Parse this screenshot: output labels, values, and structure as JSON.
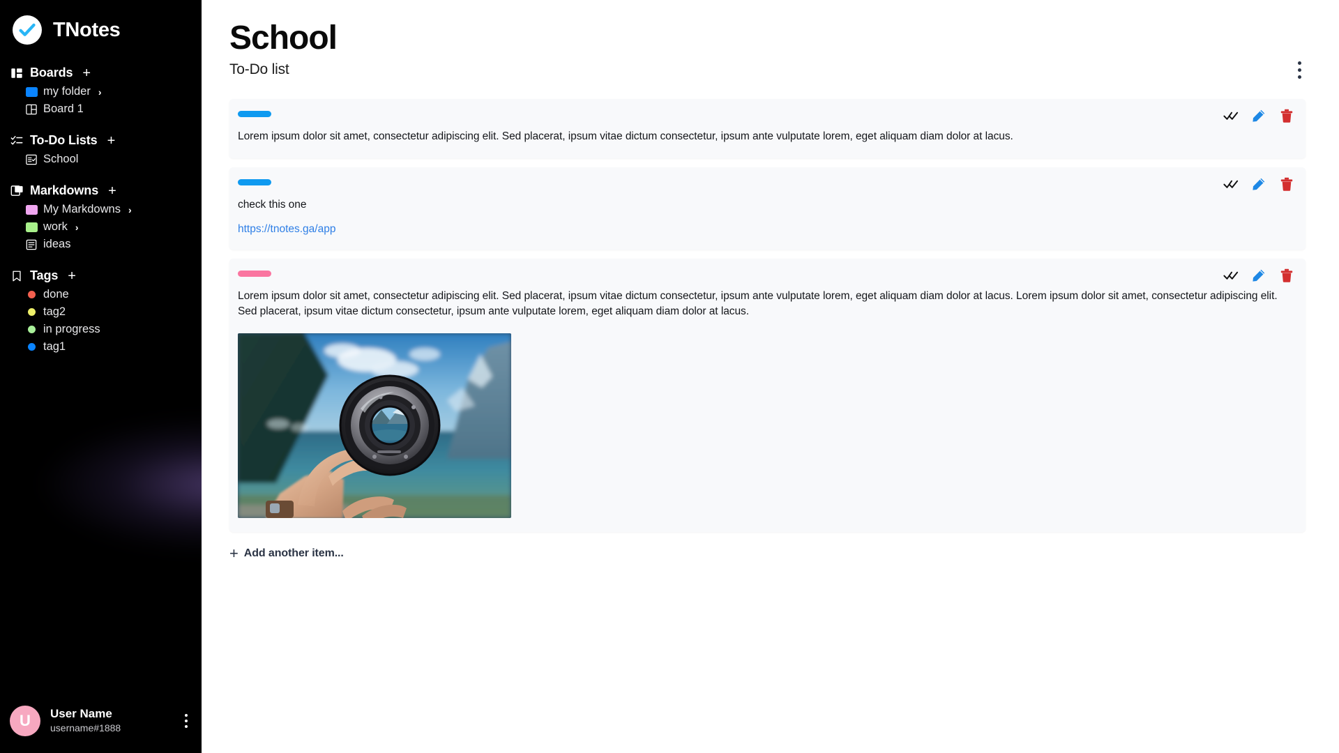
{
  "brand": {
    "name": "TNotes",
    "logo_icon": "check-circle-icon",
    "logo_color": "#29b6f6"
  },
  "sidebar": {
    "sections": [
      {
        "id": "boards",
        "title": "Boards",
        "icon": "layout-columns-icon",
        "add_label": "+",
        "items": [
          {
            "label": "my folder",
            "icon": "folder-icon",
            "color": "#0a84ff",
            "expandable": true,
            "caret": "›"
          },
          {
            "label": "Board 1",
            "icon": "board-grid-icon",
            "color": "#ffffff",
            "expandable": false,
            "caret": ""
          }
        ]
      },
      {
        "id": "todo-lists",
        "title": "To-Do Lists",
        "icon": "checklist-icon",
        "add_label": "+",
        "items": [
          {
            "label": "School",
            "icon": "list-check-icon",
            "color": "#ffffff",
            "expandable": false,
            "caret": ""
          }
        ]
      },
      {
        "id": "markdowns",
        "title": "Markdowns",
        "icon": "documents-stack-icon",
        "add_label": "+",
        "items": [
          {
            "label": "My Markdowns",
            "icon": "folder-icon",
            "color": "#f0a6f0",
            "expandable": true,
            "caret": "›"
          },
          {
            "label": "work",
            "icon": "folder-icon",
            "color": "#a8f08a",
            "expandable": true,
            "caret": "›"
          },
          {
            "label": "ideas",
            "icon": "document-icon",
            "color": "#ffffff",
            "expandable": false,
            "caret": ""
          }
        ]
      },
      {
        "id": "tags",
        "title": "Tags",
        "icon": "bookmark-icon",
        "add_label": "+",
        "items": [
          {
            "label": "done",
            "icon": "dot-icon",
            "color": "#f4604f",
            "expandable": false,
            "caret": ""
          },
          {
            "label": "tag2",
            "icon": "dot-icon",
            "color": "#eef06a",
            "expandable": false,
            "caret": ""
          },
          {
            "label": "in progress",
            "icon": "dot-icon",
            "color": "#a9f09a",
            "expandable": false,
            "caret": ""
          },
          {
            "label": "tag1",
            "icon": "dot-icon",
            "color": "#0a84ff",
            "expandable": false,
            "caret": ""
          }
        ]
      }
    ],
    "user": {
      "avatar_initial": "U",
      "avatar_color": "#f7a8c0",
      "name": "User Name",
      "handle": "username#1888",
      "menu_icon": "kebab-menu-icon"
    }
  },
  "header": {
    "title": "School",
    "subtitle": "To-Do list",
    "menu_icon": "kebab-menu-icon"
  },
  "actions": {
    "complete_icon": "double-check-icon",
    "complete_color": "#111111",
    "edit_icon": "pencil-icon",
    "edit_color": "#1e88e5",
    "delete_icon": "trash-icon",
    "delete_color": "#d32f2f"
  },
  "items": [
    {
      "id": "item-1",
      "tag_color": "#0f9af0",
      "text": "Lorem ipsum dolor sit amet, consectetur adipiscing elit. Sed placerat, ipsum vitae dictum consectetur, ipsum ante vulputate lorem, eget aliquam diam dolor at lacus.",
      "link": "",
      "has_image": false
    },
    {
      "id": "item-2",
      "tag_color": "#0f9af0",
      "text": "check this one",
      "link": "https://tnotes.ga/app",
      "has_image": false
    },
    {
      "id": "item-3",
      "tag_color": "#fa75a0",
      "text": "Lorem ipsum dolor sit amet, consectetur adipiscing elit. Sed placerat, ipsum vitae dictum consectetur, ipsum ante vulputate lorem, eget aliquam diam dolor at lacus. Lorem ipsum dolor sit amet, consectetur adipiscing elit. Sed placerat, ipsum vitae dictum consectetur, ipsum ante vulputate lorem, eget aliquam diam dolor at lacus.",
      "link": "",
      "has_image": true,
      "image_alt": "hand-holding-camera-lens-over-lake-photo"
    }
  ],
  "footer": {
    "add_item_label": "Add another item...",
    "add_icon": "plus-icon"
  }
}
